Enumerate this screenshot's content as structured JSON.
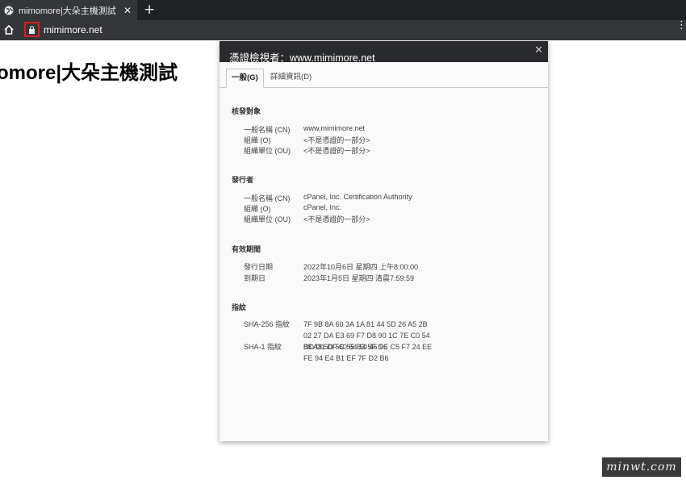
{
  "browser": {
    "tab_title": "mimomore|大朵主機測試",
    "tab_close": "✕",
    "new_tab": "+",
    "url": "mimimore.net",
    "menu": "⋮"
  },
  "page": {
    "heading": "omore|大朵主機測試"
  },
  "dialog": {
    "title": "憑證檢視者：www.mimimore.net",
    "close": "✕",
    "tabs": [
      {
        "label": "一般(G)",
        "active": true
      },
      {
        "label": "詳細資訊(D)",
        "active": false
      }
    ],
    "sections": {
      "subject": {
        "title": "核發對象",
        "rows": [
          {
            "key": "一般名稱 (CN)",
            "value": "www.mimimore.net"
          },
          {
            "key": "組織 (O)",
            "value": "<不是憑證的一部分>"
          },
          {
            "key": "組織單位 (OU)",
            "value": "<不是憑證的一部分>"
          }
        ]
      },
      "issuer": {
        "title": "發行者",
        "rows": [
          {
            "key": "一般名稱 (CN)",
            "value": "cPanel, Inc. Certification Authority"
          },
          {
            "key": "組織 (O)",
            "value": "cPanel, Inc."
          },
          {
            "key": "組織單位 (OU)",
            "value": "<不是憑證的一部分>"
          }
        ]
      },
      "validity": {
        "title": "有效期間",
        "rows": [
          {
            "key": "發行日期",
            "value": "2022年10月6日 星期四 上午8:00:00"
          },
          {
            "key": "到期日",
            "value": "2023年1月5日 星期四 清晨7:59:59"
          }
        ]
      },
      "fingerprints": {
        "title": "指紋",
        "rows": [
          {
            "key": "SHA-256 指紋",
            "value": "7F 9B 8A 60 3A 1A 81 44 5D 26 A5 2B 02 27 DA E3 69 F7 D8 90 1C 7E C0 54 88 A8 5D 5C 55 B3 5F D6"
          },
          {
            "key": "SHA-1 指紋",
            "value": "DD D1 DF 60 64 50 45 9E C5 F7 24 EE FE 94 E4 B1 EF 7F D2 B6"
          }
        ]
      }
    }
  },
  "watermark": "minwt.com",
  "colors": {
    "tabstrip": "#202124",
    "toolbar": "#35363a",
    "dialog_header": "#292a2d",
    "highlight": "#e11b1b"
  }
}
